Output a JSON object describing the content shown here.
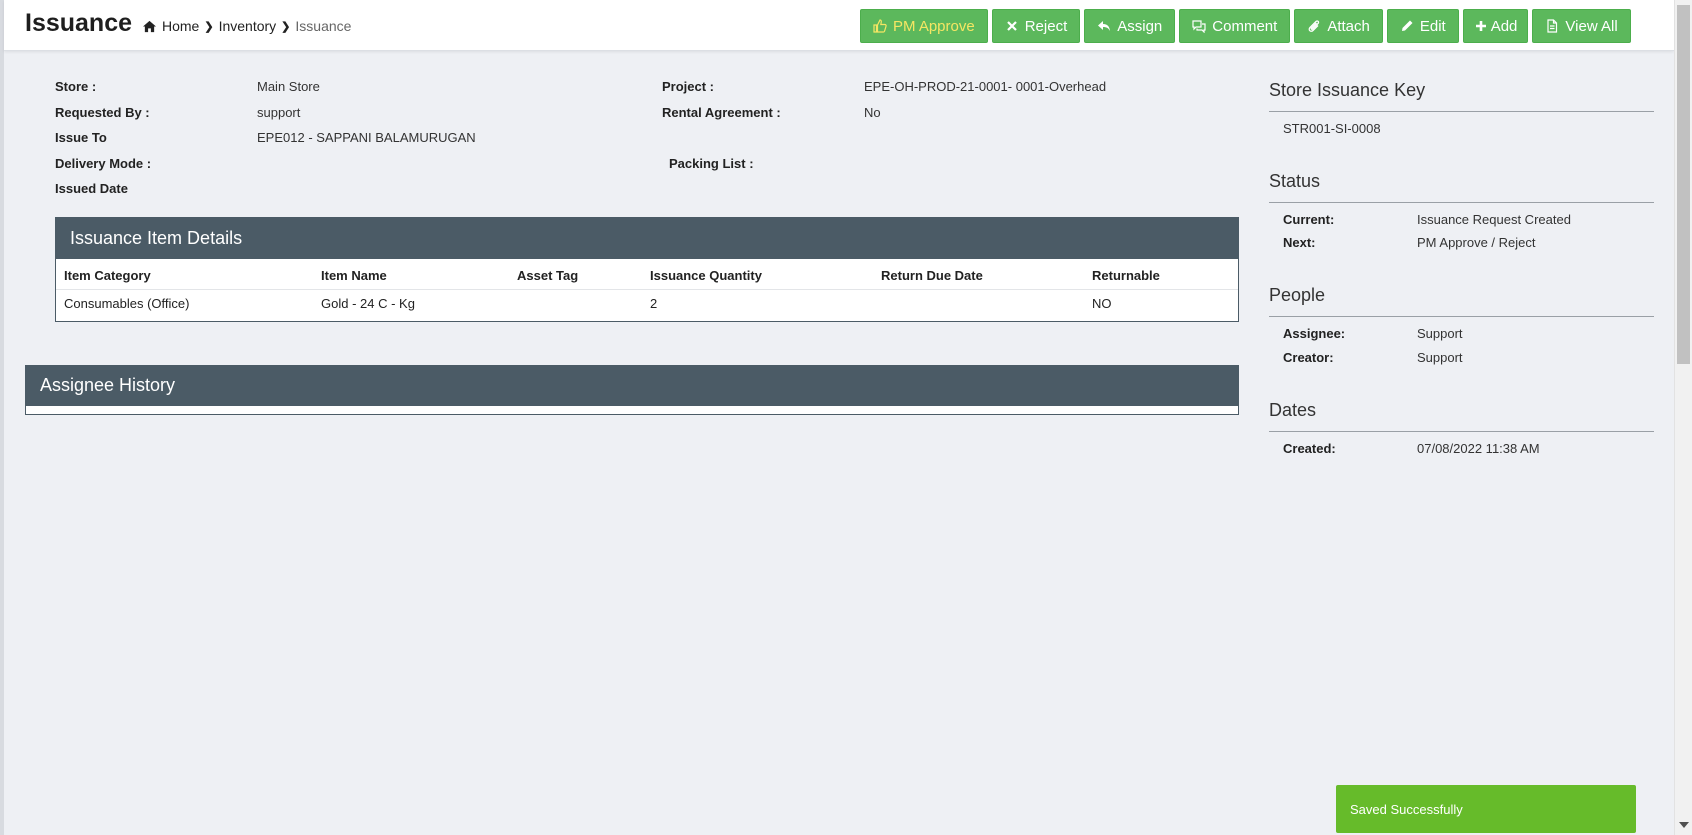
{
  "header": {
    "title": "Issuance",
    "breadcrumb": {
      "home": "Home",
      "inventory": "Inventory",
      "current": "Issuance"
    }
  },
  "toolbar": {
    "pm_approve": "PM Approve",
    "reject": "Reject",
    "assign": "Assign",
    "comment": "Comment",
    "attach": "Attach",
    "edit": "Edit",
    "add": "Add",
    "view_all": "View All"
  },
  "details": {
    "store_label": "Store :",
    "store_value": "Main Store",
    "requested_by_label": "Requested By :",
    "requested_by_value": "support",
    "issue_to_label": "Issue To",
    "issue_to_value": "EPE012 - SAPPANI BALAMURUGAN",
    "delivery_mode_label": "Delivery Mode :",
    "issued_date_label": "Issued Date",
    "project_label": "Project :",
    "project_value": "EPE-OH-PROD-21-0001- 0001-Overhead",
    "rental_label": "Rental Agreement :",
    "rental_value": "No",
    "packing_list_label": "Packing List :"
  },
  "items_panel": {
    "title": "Issuance Item Details",
    "columns": [
      "Item Category",
      "Item Name",
      "Asset Tag",
      "Issuance Quantity",
      "Return Due Date",
      "Returnable"
    ],
    "rows": [
      [
        "Consumables (Office)",
        "Gold - 24 C - Kg",
        "",
        "2",
        "",
        "NO"
      ]
    ]
  },
  "history_panel": {
    "title": "Assignee History"
  },
  "sidebar": {
    "key_title": "Store Issuance Key",
    "key_value": "STR001-SI-0008",
    "status_title": "Status",
    "current_label": "Current:",
    "current_value": "Issuance Request Created",
    "next_label": "Next:",
    "next_value": "PM Approve / Reject",
    "people_title": "People",
    "assignee_label": "Assignee:",
    "assignee_value": "Support",
    "creator_label": "Creator:",
    "creator_value": "Support",
    "dates_title": "Dates",
    "created_label": "Created:",
    "created_value": "07/08/2022 11:38 AM"
  },
  "toast": {
    "message": "Saved Successfully"
  },
  "colors": {
    "button_green": "#5cb85c",
    "panel_header": "#4b5b66",
    "toast_green": "#66bb2a"
  }
}
